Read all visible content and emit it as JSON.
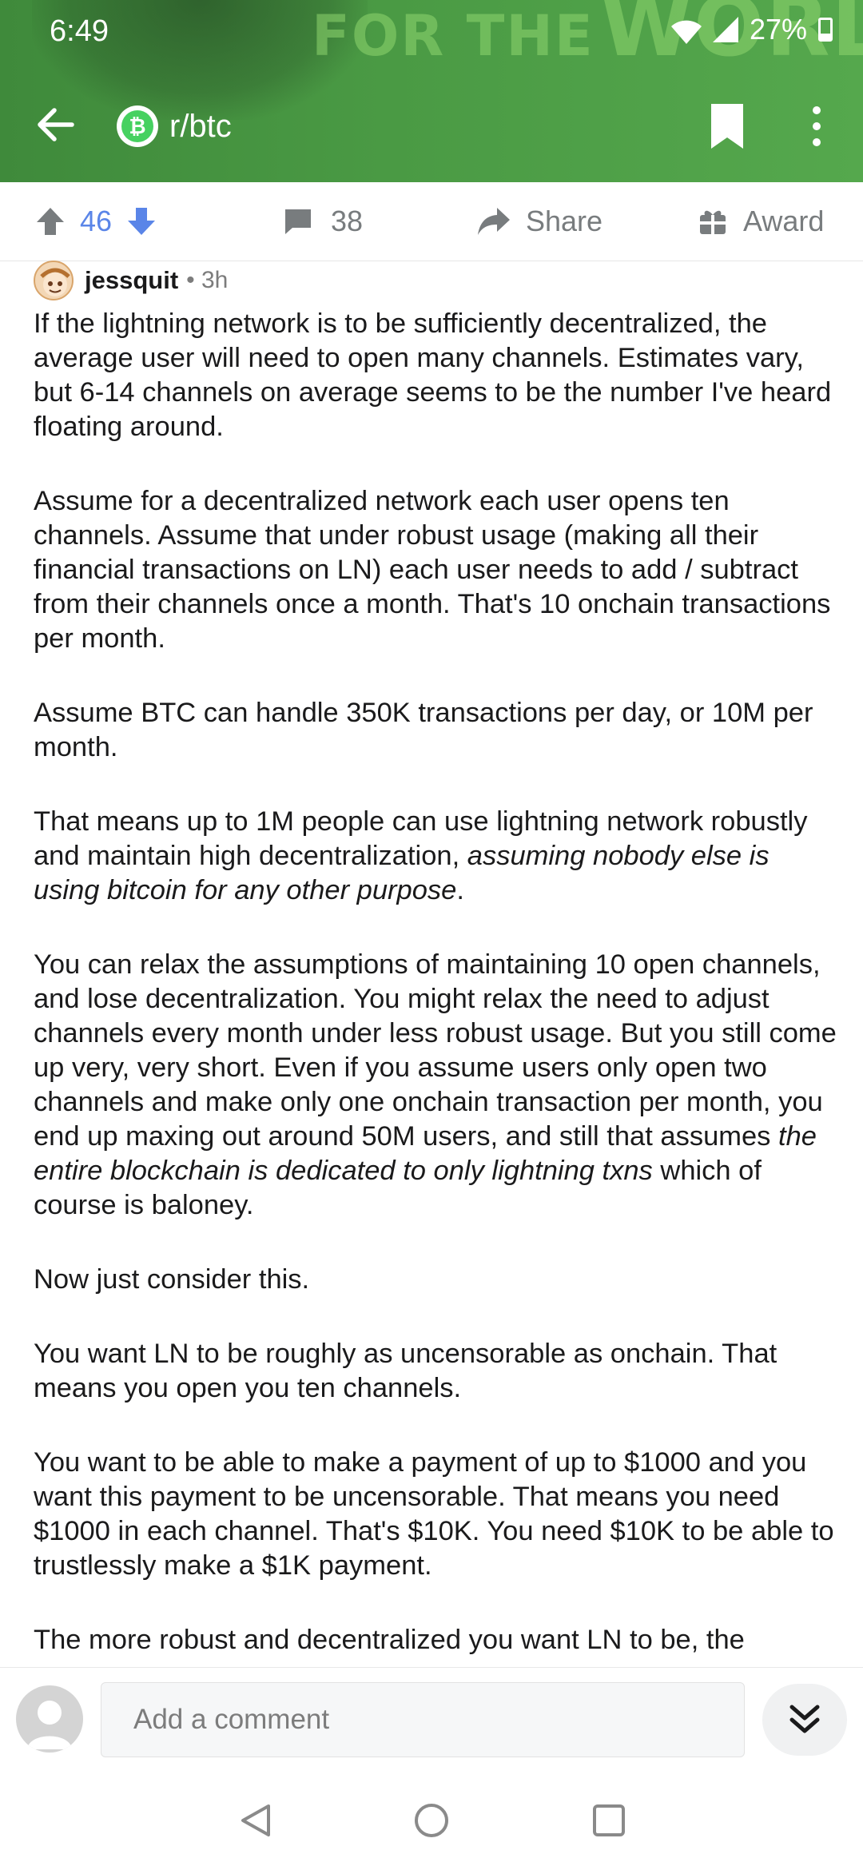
{
  "status_bar": {
    "time": "6:49",
    "battery": "27%"
  },
  "header": {
    "banner_text_line1": "FOR THE",
    "banner_text_line2": "WORLD?",
    "subreddit": "r/btc",
    "subreddit_icon_glyph": "₿"
  },
  "actions": {
    "vote_count": "46",
    "comment_count": "38",
    "share_label": "Share",
    "award_label": "Award"
  },
  "post": {
    "author": "jessquit",
    "age": "• 3h",
    "p1": "If the lightning network is to be sufficiently decentralized, the average user will need to open many channels. Estimates vary, but 6-14 channels on average seems to be the number I've heard floating around.",
    "p2": "Assume for a decentralized network  each user opens ten channels.  Assume that under robust usage (making all their financial transactions on LN) each user needs to add / subtract from their channels once a month. That's 10 onchain transactions per month.",
    "p3": "Assume BTC can handle 350K transactions per day, or 10M per month.",
    "p4_a": "That means up to 1M people can use lightning network robustly and maintain high decentralization, ",
    "p4_em": "assuming nobody else is using bitcoin for any other purpose",
    "p4_b": ".",
    "p5_a": "You can relax the assumptions of maintaining 10 open channels, and lose decentralization. You might relax the need to adjust channels every month under less robust usage. But you still come up very, very short. Even if you assume users only open two channels and make only one onchain transaction per month, you end up maxing out around 50M users, and still that assumes ",
    "p5_em": "the entire blockchain is dedicated to only lightning txns",
    "p5_b": " which of course is baloney.",
    "p6": "Now just consider this.",
    "p7": "You want LN to be roughly as uncensorable as onchain. That means you open you ten channels.",
    "p8": "You want to be able to make a payment of up to $1000 and you want this payment to be uncensorable. That means you need $1000 in each channel. That's $10K. You need $10K to be able to trustlessly make a $1K payment.",
    "p9": "The more robust and decentralized you want LN to be, the"
  },
  "comment_bar": {
    "placeholder": "Add a comment"
  },
  "icons": {
    "back": "arrow-left-icon",
    "bookmark": "bookmark-icon",
    "more": "more-vertical-icon",
    "upvote": "upvote-icon",
    "downvote": "downvote-icon",
    "comment": "comment-icon",
    "share": "share-icon",
    "award": "gift-icon",
    "expand": "double-chevron-down-icon",
    "nav_back": "triangle-back-icon",
    "nav_home": "circle-home-icon",
    "nav_recents": "square-recents-icon"
  },
  "colors": {
    "header_green": "#4a9a44",
    "vote_blue": "#5a85e8",
    "muted_gray": "#787c7e"
  }
}
